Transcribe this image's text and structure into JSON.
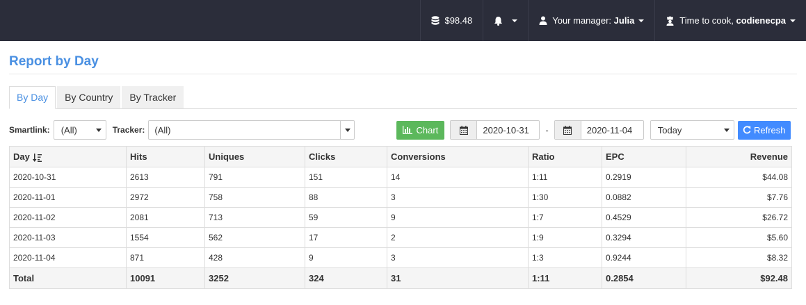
{
  "navbar": {
    "balance": "$98.48",
    "manager_prefix": "Your manager: ",
    "manager_name": "Julia",
    "user_prefix": "Time to cook, ",
    "user_name": "codienecpa"
  },
  "page": {
    "title": "Report by Day"
  },
  "tabs": [
    {
      "label": "By Day",
      "active": true
    },
    {
      "label": "By Country",
      "active": false
    },
    {
      "label": "By Tracker",
      "active": false
    }
  ],
  "filters": {
    "smartlink_label": "Smartlink:",
    "smartlink_value": "(All)",
    "tracker_label": "Tracker:",
    "tracker_value": "(All)",
    "chart_label": "Chart",
    "date_from": "2020-10-31",
    "date_sep": "-",
    "date_to": "2020-11-04",
    "period_value": "Today",
    "refresh_label": "Refresh"
  },
  "table": {
    "headers": [
      "Day",
      "Hits",
      "Uniques",
      "Clicks",
      "Conversions",
      "Ratio",
      "EPC",
      "Revenue"
    ],
    "rows": [
      [
        "2020-10-31",
        "2613",
        "791",
        "151",
        "14",
        "1:11",
        "0.2919",
        "$44.08"
      ],
      [
        "2020-11-01",
        "2972",
        "758",
        "88",
        "3",
        "1:30",
        "0.0882",
        "$7.76"
      ],
      [
        "2020-11-02",
        "2081",
        "713",
        "59",
        "9",
        "1:7",
        "0.4529",
        "$26.72"
      ],
      [
        "2020-11-03",
        "1554",
        "562",
        "17",
        "2",
        "1:9",
        "0.3294",
        "$5.60"
      ],
      [
        "2020-11-04",
        "871",
        "428",
        "9",
        "3",
        "1:3",
        "0.9244",
        "$8.32"
      ]
    ],
    "total": [
      "Total",
      "10091",
      "3252",
      "324",
      "31",
      "1:11",
      "0.2854",
      "$92.48"
    ]
  },
  "colors": {
    "navbar": "#2b2d3a",
    "accent": "#4a90e2",
    "chart_button": "#5cb85c",
    "refresh_button": "#428bff"
  },
  "icons": {
    "balance": "database-icon",
    "notifications": "bell-icon",
    "manager": "user-icon",
    "user": "chef-icon",
    "chart": "bar-chart-icon",
    "calendar": "calendar-icon",
    "refresh": "refresh-icon",
    "sort": "sort-desc-icon"
  }
}
